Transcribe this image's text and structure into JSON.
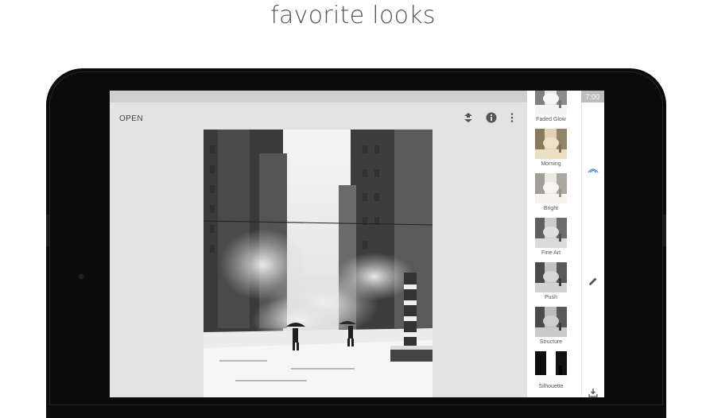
{
  "headline": "favorite looks",
  "status": {
    "time": "7:00"
  },
  "toolbar": {
    "open_label": "OPEN"
  },
  "looks": [
    {
      "label": "Faded Glow"
    },
    {
      "label": "Morning"
    },
    {
      "label": "Bright"
    },
    {
      "label": "Fine Art"
    },
    {
      "label": "Push"
    },
    {
      "label": "Structure"
    },
    {
      "label": "Silhouette"
    }
  ],
  "colors": {
    "accent": "#4285f4",
    "screen_bg": "#e3e3e3",
    "device": "#0b0b0b"
  },
  "icons": {
    "toolbar": [
      "compare-icon",
      "info-icon",
      "more-vert-icon"
    ],
    "tools": [
      "looks-icon",
      "tools-pencil-icon",
      "export-icon"
    ]
  }
}
